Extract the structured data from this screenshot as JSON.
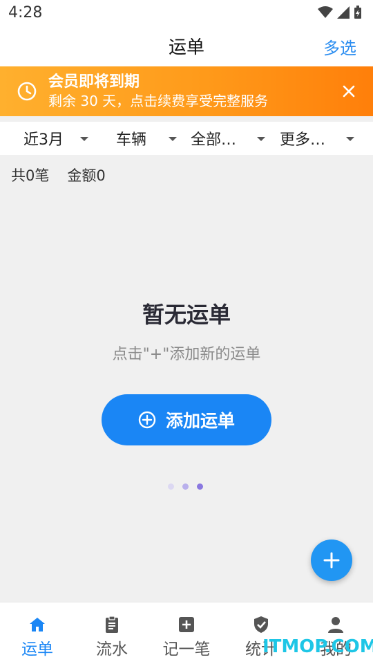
{
  "statusbar": {
    "time": "4:28"
  },
  "header": {
    "title": "运单",
    "multi_select": "多选"
  },
  "banner": {
    "title": "会员即将到期",
    "subtitle": "剩余 30 天，点击续费享受完整服务",
    "accent": "#ff9a1a"
  },
  "filters": [
    {
      "label": "近3月"
    },
    {
      "label": "车辆"
    },
    {
      "label": "全部…"
    },
    {
      "label": "更多…"
    }
  ],
  "summary": {
    "count": "共0笔",
    "amount": "金额0"
  },
  "empty": {
    "title": "暂无运单",
    "subtitle": "点击\"+\"添加新的运单",
    "button_label": "添加运单",
    "button_color": "#1a86f5"
  },
  "pager": {
    "dots": 3,
    "active": 3
  },
  "fab": {
    "icon": "plus-icon",
    "color": "#2196f3"
  },
  "bottom_nav": [
    {
      "label": "运单",
      "icon": "home-icon",
      "active": true
    },
    {
      "label": "流水",
      "icon": "clipboard-icon",
      "active": false
    },
    {
      "label": "记一笔",
      "icon": "plus-square-icon",
      "active": false
    },
    {
      "label": "统计",
      "icon": "shield-check-icon",
      "active": false
    },
    {
      "label": "我的",
      "icon": "person-icon",
      "active": false
    }
  ],
  "watermark": "ITMOP.COM"
}
